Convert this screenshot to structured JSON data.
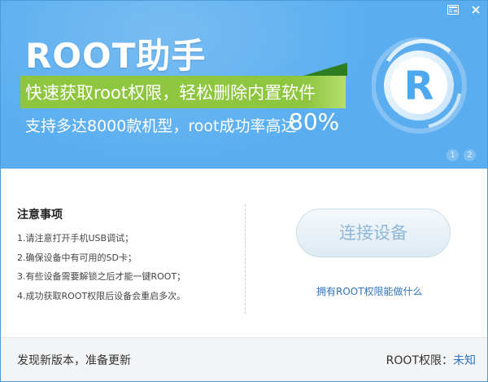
{
  "window": {
    "controls": {
      "feedback_icon": "feedback-icon",
      "close_icon": "close-icon"
    }
  },
  "banner": {
    "title": "ROOT助手",
    "slogan": "快速获取root权限，轻松删除内置软件",
    "subline": "支持多达8000款机型，root成功率高达",
    "success_rate": "80%",
    "logo_letter": "R",
    "pager": [
      "1",
      "2"
    ],
    "colors": {
      "banner_bg": "#5aaef0",
      "slogan_bg": "#8ec63f",
      "logo_letter": "#4ea8ee"
    }
  },
  "notes": {
    "title": "注意事项",
    "items": [
      "1.请注意打开手机USB调试；",
      "2.确保设备中有可用的SD卡；",
      "3.有些设备需要解锁之后才能一键ROOT；",
      "4.成功获取ROOT权限后设备会重启多次。"
    ]
  },
  "actions": {
    "connect_label": "连接设备",
    "root_info_link": "拥有ROOT权限能做什么"
  },
  "footer": {
    "update_text": "发现新版本，准备更新",
    "root_status_label": "ROOT权限：",
    "root_status_value": "未知",
    "colors": {
      "link": "#2f74c4"
    }
  }
}
